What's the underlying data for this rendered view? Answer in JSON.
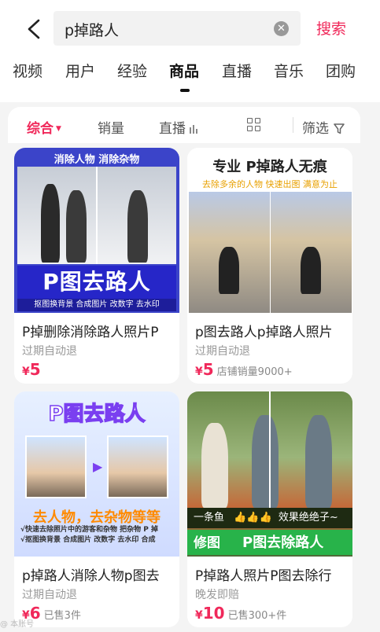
{
  "header": {
    "query": "p掉路人",
    "search_label": "搜索"
  },
  "tabs": [
    "视频",
    "用户",
    "经验",
    "商品",
    "直播",
    "音乐",
    "团购"
  ],
  "active_tab": "商品",
  "filters": {
    "sort_label": "综合",
    "sales_label": "销量",
    "live_label": "直播",
    "filter_label": "筛选"
  },
  "accent_color": "#f0285a",
  "products": [
    {
      "title": "P掉删除消除路人照片P",
      "subtitle": "过期自动退",
      "currency": "¥",
      "price": "5",
      "sold": "",
      "image_text": {
        "top": "消除人物 消除杂物",
        "banner": "P图去路人",
        "bottom": "抠图换背景 合成图片 改数字 去水印"
      }
    },
    {
      "title": "p图去路人p掉路人照片",
      "subtitle": "过期自动退",
      "currency": "¥",
      "price": "5",
      "sold": "店铺销量9000+",
      "image_text": {
        "top": "专业 P掉路人无痕",
        "sub": "去除多余的人物 快速出图 满意为止"
      }
    },
    {
      "title": "p掉路人消除人物p图去",
      "subtitle": "过期自动退",
      "currency": "¥",
      "price": "6",
      "sold": "已售3件",
      "image_text": {
        "top": "P图去路人",
        "mid": "去人物，去杂物等等",
        "line1": "√快速去除照片中的游客和杂物 把杂物 P 掉",
        "line2": "√抠图换背景 合成图片 改数字 去水印 合成"
      }
    },
    {
      "title": "P掉路人照片P图去除行",
      "subtitle": "晚发即赔",
      "currency": "¥",
      "price": "10",
      "sold": "已售300+件",
      "image_text": {
        "strip_left": "一条鱼",
        "strip_right": "效果绝绝子~",
        "green_left": "修图",
        "green_right": "P图去除路人"
      }
    }
  ],
  "watermark": "@ 本账号"
}
